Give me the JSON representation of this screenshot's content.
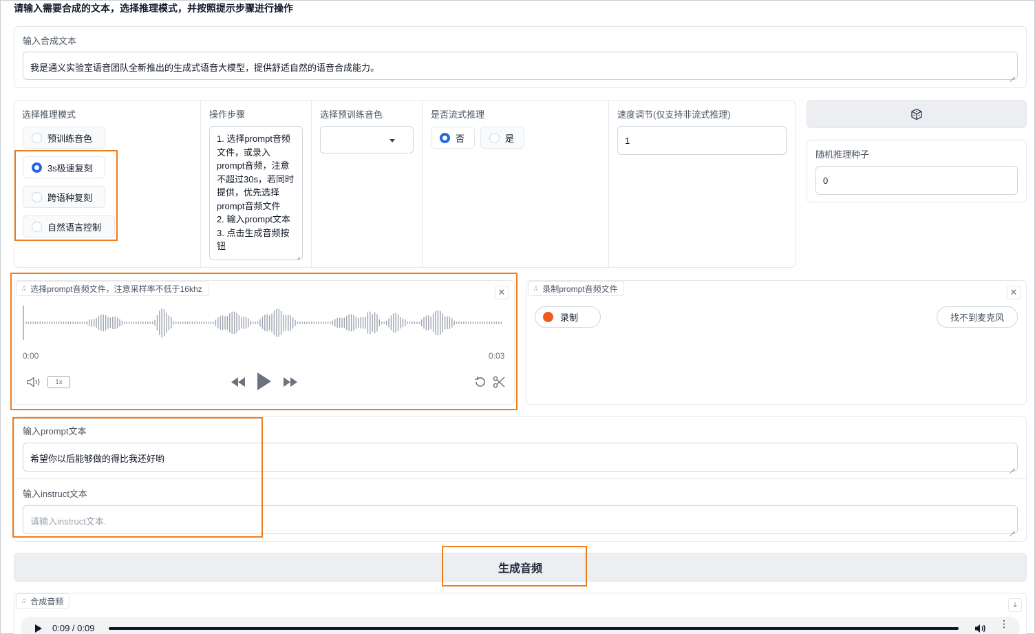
{
  "page": {
    "heading": "请输入需要合成的文本，选择推理模式，并按照提示步骤进行操作"
  },
  "synth_text": {
    "label": "输入合成文本",
    "value": "我是通义实验室语音团队全新推出的生成式语音大模型，提供舒适自然的语音合成能力。"
  },
  "mode": {
    "label": "选择推理模式",
    "options": [
      "预训练音色",
      "3s极速复刻",
      "跨语种复刻",
      "自然语言控制"
    ],
    "selected": "3s极速复刻"
  },
  "steps": {
    "label": "操作步骤",
    "text": "1. 选择prompt音频文件，或录入prompt音频，注意不超过30s，若同时提供，优先选择prompt音频文件\n2. 输入prompt文本\n3. 点击生成音频按钮"
  },
  "voice": {
    "label": "选择预训练音色",
    "value": ""
  },
  "stream": {
    "label": "是否流式推理",
    "options": [
      "否",
      "是"
    ],
    "selected": "否"
  },
  "speed": {
    "label": "速度调节(仅支持非流式推理)",
    "value": "1"
  },
  "dice": {
    "icon": "dice-icon"
  },
  "seed": {
    "label": "随机推理种子",
    "value": "0"
  },
  "prompt_audio": {
    "label": "选择prompt音频文件，注意采样率不低于16khz",
    "time_start": "0:00",
    "time_end": "0:03",
    "playback_rate": "1x"
  },
  "record_audio": {
    "label": "录制prompt音频文件",
    "record_label": "录制",
    "mic_label": "找不到麦克风"
  },
  "prompt_text": {
    "label": "输入prompt文本",
    "value": "希望你以后能够做的得比我还好哟"
  },
  "instruct_text": {
    "label": "输入instruct文本",
    "placeholder": "请输入instruct文本."
  },
  "generate": {
    "label": "生成音频"
  },
  "output_audio": {
    "label": "合成音频",
    "time": "0:09 / 0:09"
  },
  "colors": {
    "highlight": "#f07d1c",
    "radio_checked": "#2563eb",
    "record_dot": "#f05a1a"
  }
}
